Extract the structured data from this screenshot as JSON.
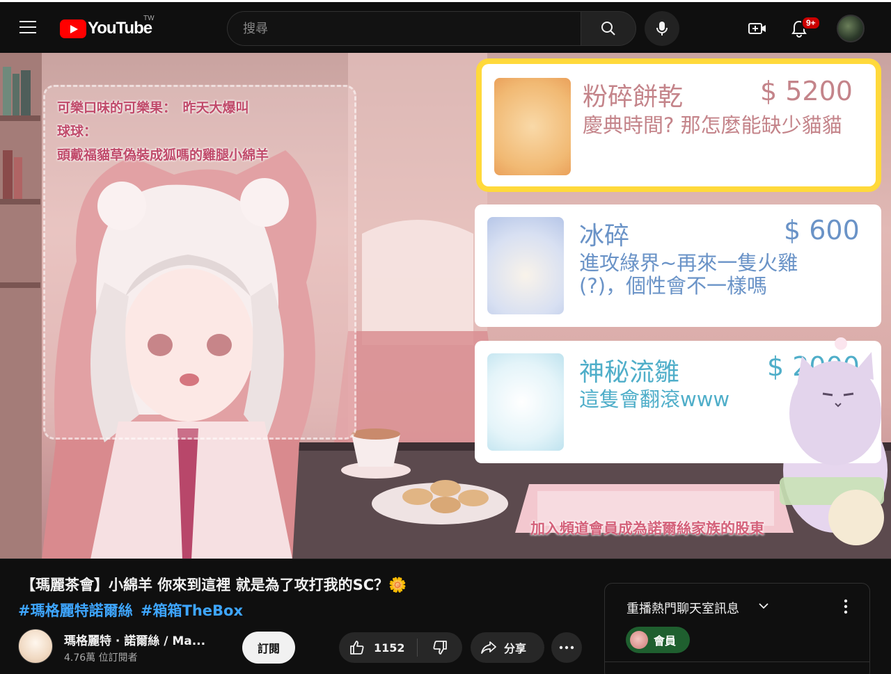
{
  "header": {
    "logo_text": "YouTube",
    "region": "TW",
    "search_placeholder": "搜尋",
    "notifications_badge": "9+",
    "icons": [
      "menu-icon",
      "search-icon",
      "mic-icon",
      "create-icon",
      "bell-icon"
    ],
    "brand_color": "#ff0000"
  },
  "video": {
    "chat_lines": [
      "可樂口味的可樂果：　昨天大爆叫",
      "球球：",
      "頭戴福貓草偽裝成狐嗎的雞腿小綿羊"
    ],
    "superchats": [
      {
        "name": "粉碎餅乾",
        "amount": "$ 5200",
        "message": "慶典時間? 那怎麼能缺少貓貓"
      },
      {
        "name": "冰碎",
        "amount": "$ 600",
        "message": "進攻綠界~再來一隻火雞(?)，個性會不一樣嗎"
      },
      {
        "name": "神秘流雛",
        "amount": "$ 2000",
        "message": "這隻會翻滾www"
      }
    ],
    "member_banner": "加入頻道會員成為諾爾絲家族的股東"
  },
  "info": {
    "title": "【瑪麗茶會】小綿羊 你來到這裡 就是為了攻打我的SC？🌼",
    "hashtags": [
      "#瑪格麗特諾爾絲",
      "#箱箱TheBox"
    ],
    "channel_name": "瑪格麗特 · 諾爾絲 / Ma...",
    "subscribers": "4.76萬 位訂閱者",
    "subscribe_label": "訂閱",
    "like_count": "1152",
    "share_label": "分享",
    "link_color": "#3ea6ff"
  },
  "chat_panel": {
    "title": "重播熱門聊天室訊息",
    "member_chip": "會員",
    "chip_color": "#1f5f2f"
  }
}
